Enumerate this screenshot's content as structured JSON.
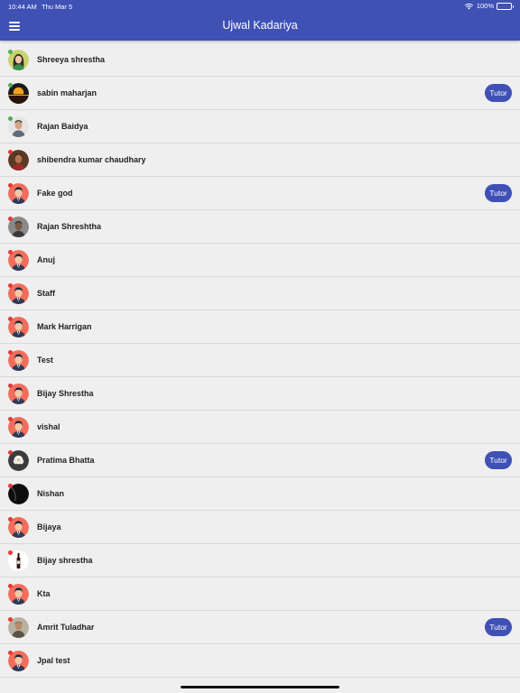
{
  "status_bar": {
    "time": "10:44 AM",
    "date": "Thu Mar 5",
    "battery": "100%"
  },
  "header": {
    "title": "Ujwal Kadariya",
    "menu_icon": "hamburger-menu-icon"
  },
  "colors": {
    "primary": "#3f51b5",
    "online": "#4caf50",
    "offline": "#e53935"
  },
  "users": [
    {
      "name": "Shreeya shrestha",
      "tutor": "",
      "online": true,
      "avatar": "female"
    },
    {
      "name": "sabin maharjan",
      "tutor": "Tutor",
      "online": true,
      "avatar": "sunset"
    },
    {
      "name": "Rajan Baidya",
      "tutor": "",
      "online": true,
      "avatar": "photo-light"
    },
    {
      "name": "shibendra kumar chaudhary",
      "tutor": "",
      "online": false,
      "avatar": "photo-dark"
    },
    {
      "name": "Fake god",
      "tutor": "Tutor",
      "online": false,
      "avatar": "default"
    },
    {
      "name": "Rajan Shreshtha",
      "tutor": "",
      "online": false,
      "avatar": "photo-grey"
    },
    {
      "name": "Anuj",
      "tutor": "",
      "online": false,
      "avatar": "default"
    },
    {
      "name": "Staff",
      "tutor": "",
      "online": false,
      "avatar": "default"
    },
    {
      "name": "Mark Harrigan",
      "tutor": "",
      "online": false,
      "avatar": "default"
    },
    {
      "name": "Test",
      "tutor": "",
      "online": false,
      "avatar": "default"
    },
    {
      "name": "Bijay Shrestha",
      "tutor": "",
      "online": false,
      "avatar": "default"
    },
    {
      "name": "vishal",
      "tutor": "",
      "online": false,
      "avatar": "default"
    },
    {
      "name": "Pratima Bhatta",
      "tutor": "Tutor",
      "online": false,
      "avatar": "flower"
    },
    {
      "name": "Nishan",
      "tutor": "",
      "online": false,
      "avatar": "dark"
    },
    {
      "name": "Bijaya",
      "tutor": "",
      "online": false,
      "avatar": "default"
    },
    {
      "name": "Bijay shrestha",
      "tutor": "",
      "online": false,
      "avatar": "bottle"
    },
    {
      "name": "Kta",
      "tutor": "",
      "online": false,
      "avatar": "default"
    },
    {
      "name": "Amrit Tuladhar",
      "tutor": "Tutor",
      "online": false,
      "avatar": "photo-outdoor"
    },
    {
      "name": "Jpal test",
      "tutor": "",
      "online": false,
      "avatar": "default"
    }
  ]
}
